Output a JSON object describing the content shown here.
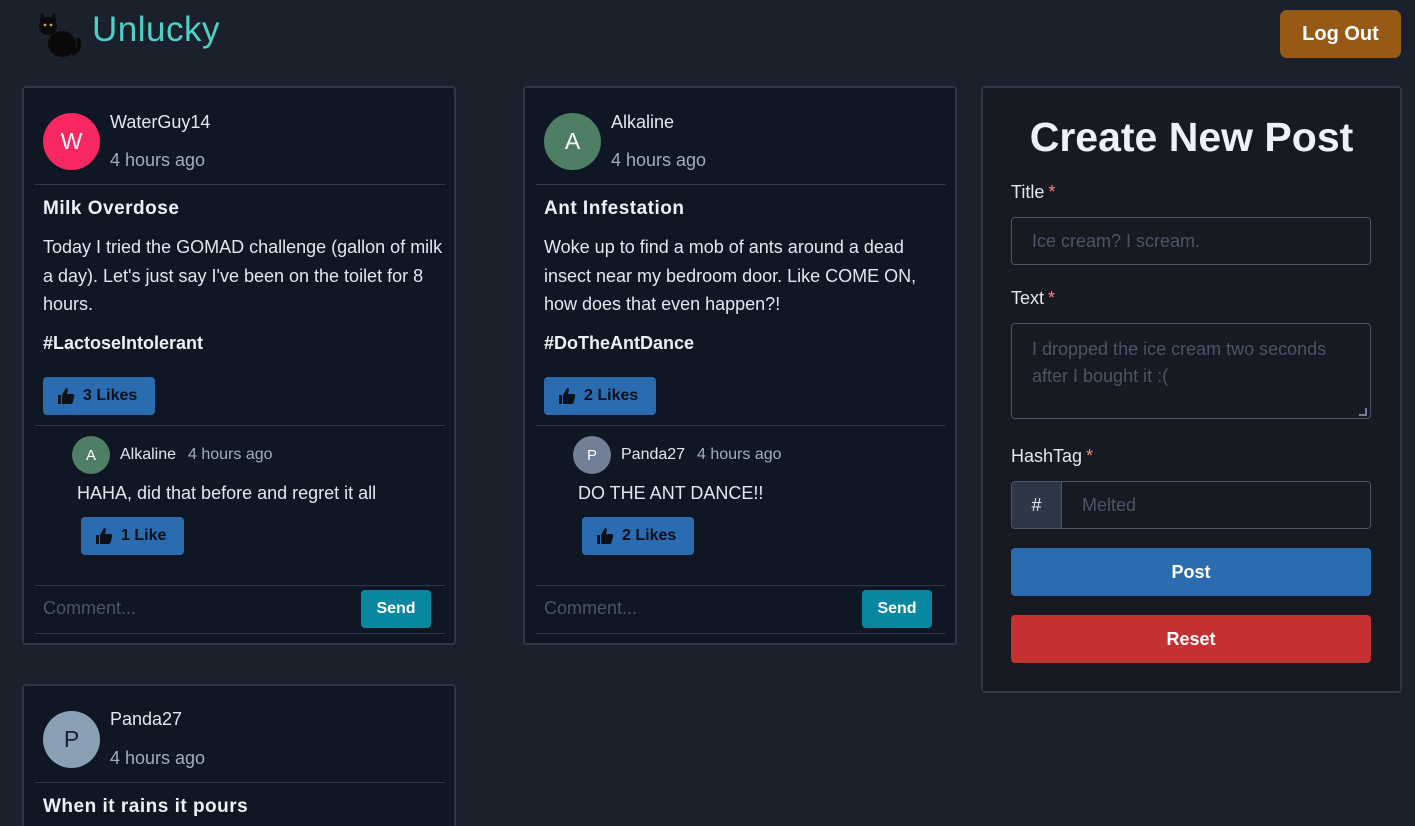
{
  "app": {
    "brand": "Unlucky",
    "logout_label": "Log Out"
  },
  "posts": [
    {
      "avatar_letter": "W",
      "avatar_color": "#f6285f",
      "author": "WaterGuy14",
      "time": "4 hours ago",
      "title": "Milk Overdose",
      "text": "Today I tried the GOMAD challenge (gallon of milk a day). Let's just say I've been on the toilet for 8 hours.",
      "hashtag": "#LactoseIntolerant",
      "likes_label": "3 Likes",
      "comment": {
        "avatar_letter": "A",
        "avatar_color": "#4e7e64",
        "author": "Alkaline",
        "time": "4 hours ago",
        "text": "HAHA, did that before and regret it all",
        "likes_label": "1 Like"
      },
      "comment_placeholder": "Comment...",
      "send_label": "Send"
    },
    {
      "avatar_letter": "A",
      "avatar_color": "#4e7e64",
      "author": "Alkaline",
      "time": "4 hours ago",
      "title": "Ant Infestation",
      "text": "Woke up to find a mob of ants around a dead insect near my bedroom door. Like COME ON, how does that even happen?!",
      "hashtag": "#DoTheAntDance",
      "likes_label": "2 Likes",
      "comment": {
        "avatar_letter": "P",
        "avatar_color": "#718096",
        "author": "Panda27",
        "time": "4 hours ago",
        "text": "DO THE ANT DANCE!!",
        "likes_label": "2 Likes"
      },
      "comment_placeholder": "Comment...",
      "send_label": "Send"
    },
    {
      "avatar_letter": "P",
      "avatar_color": "#8aa0b5",
      "author": "Panda27",
      "time": "4 hours ago",
      "title": "When it rains it pours"
    }
  ],
  "create_form": {
    "heading": "Create New Post",
    "title_label": "Title",
    "title_placeholder": "Ice cream? I scream.",
    "text_label": "Text",
    "text_placeholder": "I dropped the ice cream two seconds after I bought it :(",
    "hashtag_label": "HashTag",
    "hashtag_prefix": "#",
    "hashtag_placeholder": "Melted",
    "required_mark": "*",
    "post_label": "Post",
    "reset_label": "Reset"
  }
}
